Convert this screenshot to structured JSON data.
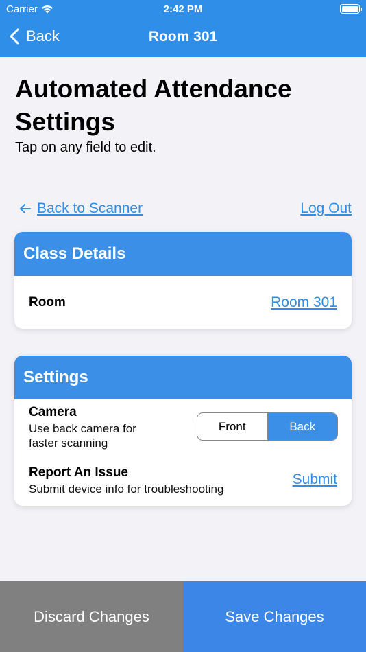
{
  "status_bar": {
    "carrier": "Carrier",
    "time": "2:42 PM"
  },
  "nav": {
    "back_label": "Back",
    "title": "Room 301"
  },
  "page": {
    "title": "Automated Attendance Settings",
    "subtitle": "Tap on any field to edit."
  },
  "links": {
    "back_to_scanner": "Back to Scanner",
    "log_out": "Log Out"
  },
  "class_details": {
    "header": "Class Details",
    "room_label": "Room",
    "room_value": "Room 301"
  },
  "settings": {
    "header": "Settings",
    "camera_label": "Camera",
    "camera_desc": "Use back camera for faster scanning",
    "camera_options": [
      "Front",
      "Back"
    ],
    "camera_selected": "Back",
    "report_label": "Report An Issue",
    "report_desc": "Submit device info for troubleshooting",
    "report_action": "Submit"
  },
  "footer": {
    "discard": "Discard Changes",
    "save": "Save Changes"
  },
  "colors": {
    "accent": "#2f8fe8",
    "discard": "#808080",
    "save": "#3b86e6"
  }
}
